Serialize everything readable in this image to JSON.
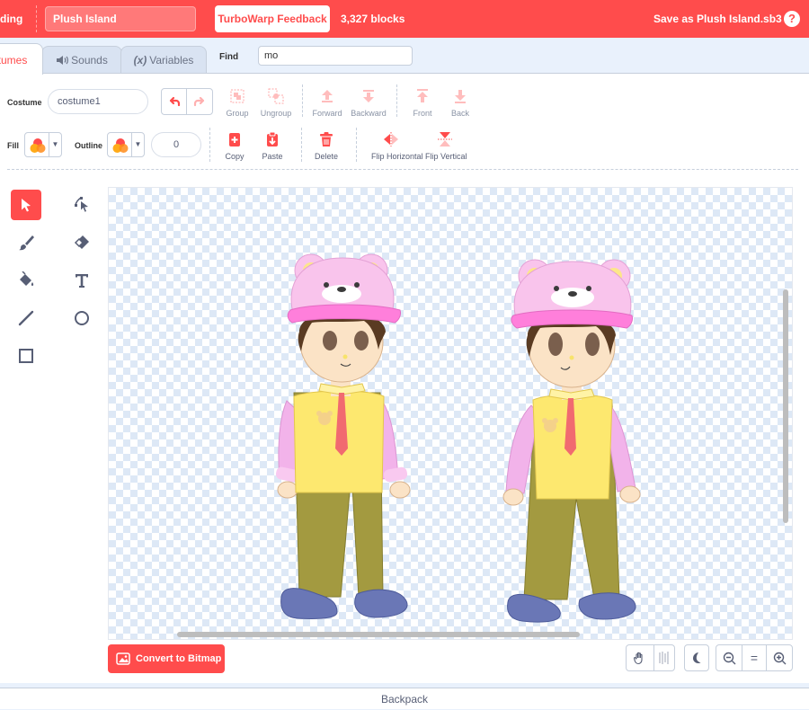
{
  "topbar": {
    "cut_label": "ding",
    "project_title": "Plush Island",
    "feedback_label": "TurboWarp Feedback",
    "block_count": "3,327 blocks",
    "save_label": "Save as Plush Island.sb3",
    "help_label": "?"
  },
  "tabs": {
    "costumes": "tumes",
    "sounds": "Sounds",
    "variables": "Variables"
  },
  "find": {
    "label": "Find",
    "value": "mo"
  },
  "costume": {
    "label": "Costume",
    "name": "costume1"
  },
  "fill": {
    "label": "Fill"
  },
  "outline": {
    "label": "Outline",
    "width": "0"
  },
  "toolbar": {
    "group": "Group",
    "ungroup": "Ungroup",
    "forward": "Forward",
    "backward": "Backward",
    "front": "Front",
    "back": "Back",
    "copy": "Copy",
    "paste": "Paste",
    "delete": "Delete",
    "flip_horizontal": "Flip Horizontal",
    "flip_vertical": "Flip Vertical"
  },
  "tools": [
    "select-icon",
    "reshape-icon",
    "brush-icon",
    "eraser-icon",
    "fill-icon",
    "text-icon",
    "line-icon",
    "circle-icon",
    "rectangle-icon"
  ],
  "convert_label": "Convert to Bitmap",
  "zoom": {
    "equal_label": "="
  },
  "backpack_label": "Backpack",
  "colors": {
    "accent": "#ff4c4c",
    "text": "#575e75",
    "panel_bg": "#e9f1fc",
    "checker": "#dde8f6"
  }
}
